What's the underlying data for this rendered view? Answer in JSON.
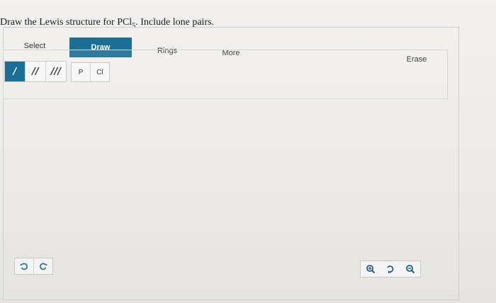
{
  "prompt": {
    "before": "Draw the Lewis structure for PCl",
    "subscript": "5",
    "after": ". Include lone pairs."
  },
  "tabs": {
    "select": "Select",
    "draw": "Draw",
    "rings": "Rings",
    "more": "More",
    "erase": "Erase"
  },
  "bonds": {
    "single": "/",
    "double": "//",
    "triple": "///"
  },
  "atoms": {
    "p": "P",
    "cl": "Cl"
  },
  "icons": {
    "undo": "undo-icon",
    "redo": "redo-icon",
    "zoom_in": "zoom-in-icon",
    "reset": "reset-view-icon",
    "zoom_out": "zoom-out-icon"
  },
  "colors": {
    "accent": "#1b6f97",
    "zoom_icon": "#1b5f84",
    "undo_icon": "#1b6f97",
    "redo_icon": "#1b6f97"
  }
}
